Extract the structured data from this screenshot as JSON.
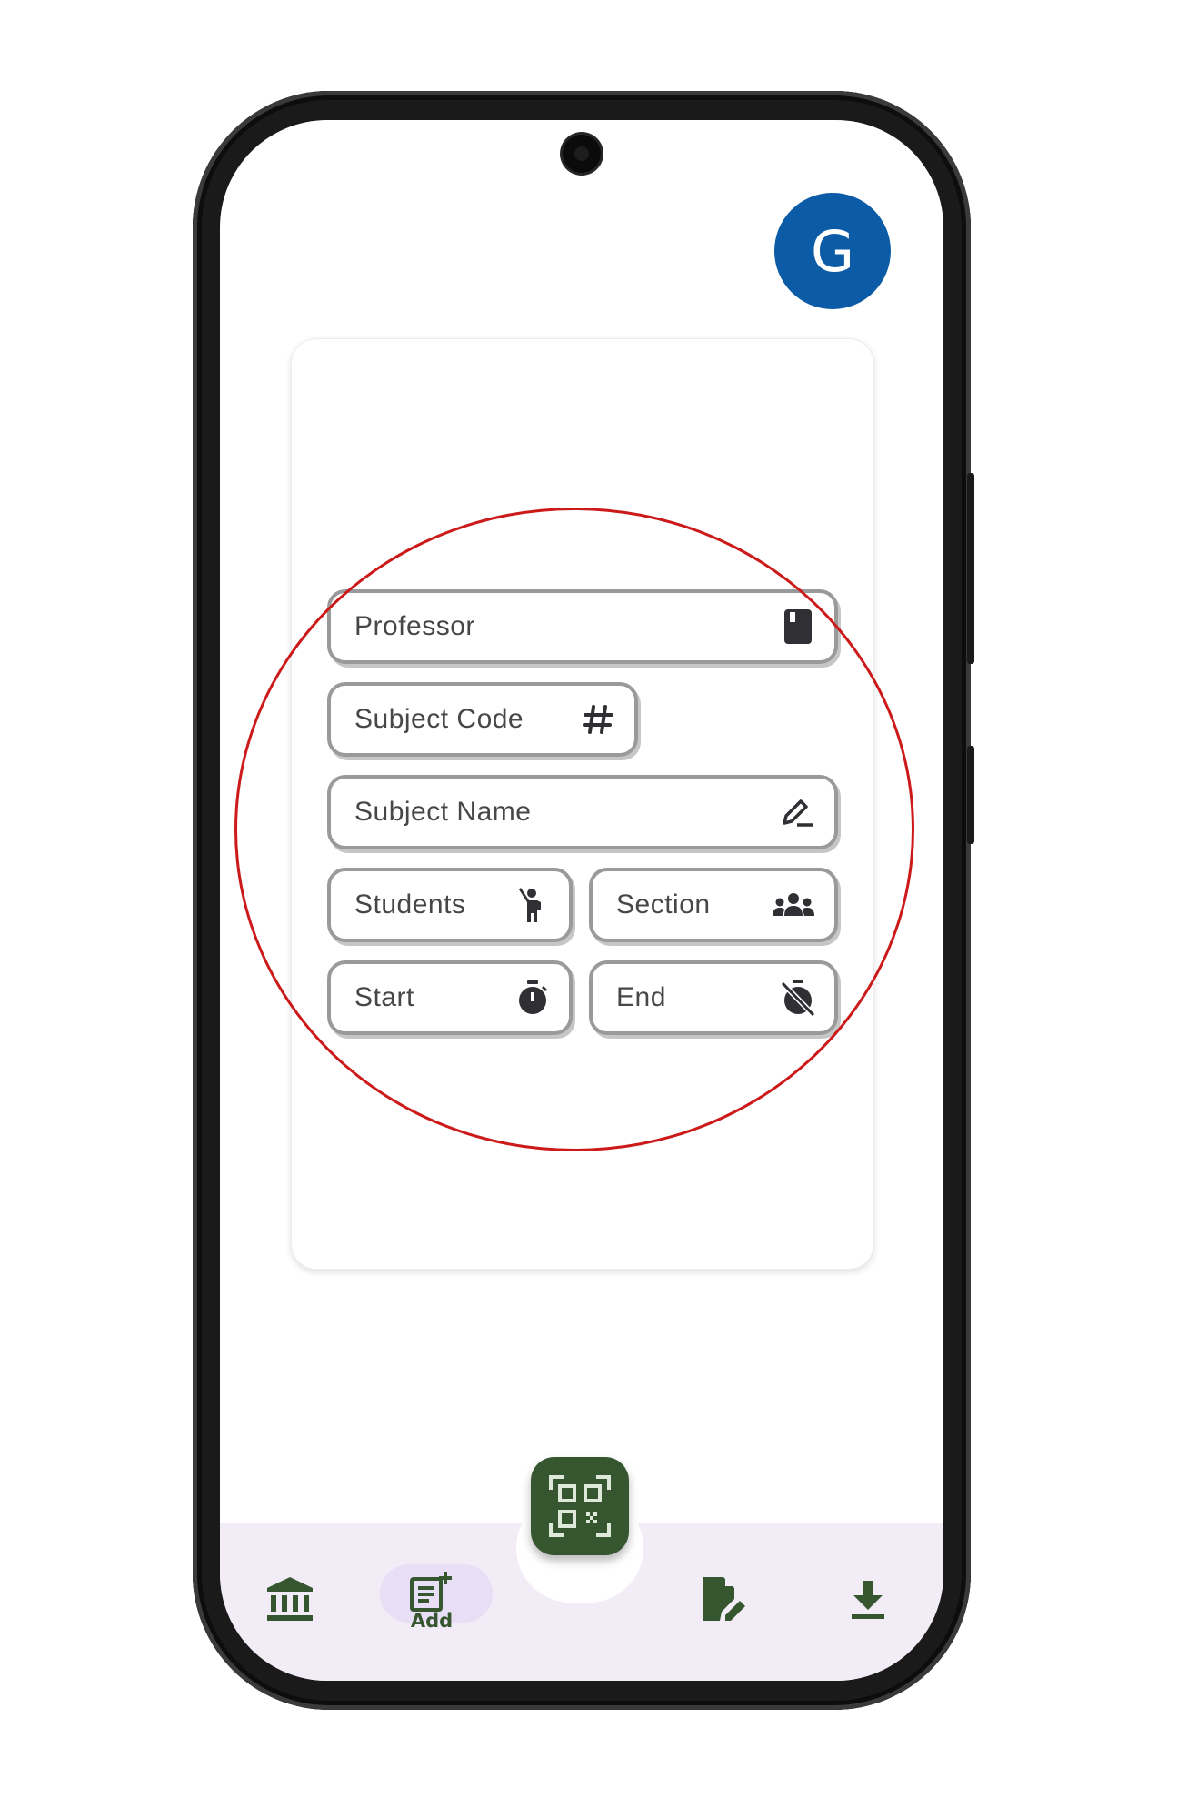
{
  "profile": {
    "avatar_letter": "G"
  },
  "form": {
    "professor_label": "Professor",
    "subject_code_label": "Subject Code",
    "subject_name_label": "Subject Name",
    "students_label": "Students",
    "section_label": "Section",
    "start_label": "Start",
    "end_label": "End"
  },
  "nav": {
    "add_label": "Add",
    "items": [
      "institution-icon",
      "add-note-icon",
      "qr-scan-icon",
      "edit-document-icon",
      "download-icon"
    ]
  },
  "colors": {
    "accent": "#36562f",
    "avatar": "#0b5ba6",
    "nav_background": "#f2ecf7",
    "nav_active_pill": "#e8def5",
    "highlight_circle": "#cc1a1a",
    "field_border": "#9a9a9a"
  }
}
